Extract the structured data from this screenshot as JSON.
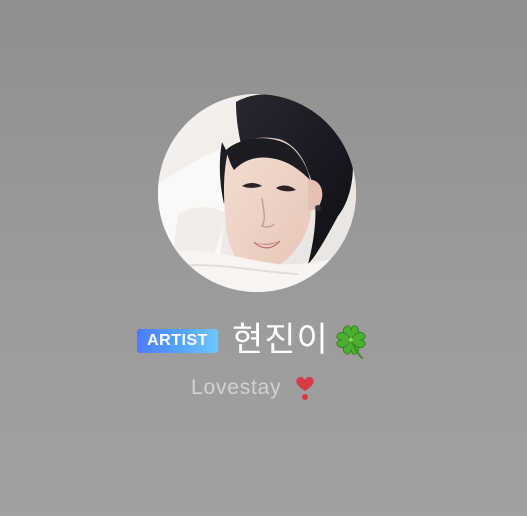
{
  "profile": {
    "badge": "ARTIST",
    "name": "현진이",
    "name_icon": "four-leaf-clover-icon",
    "bio": "Lovestay",
    "bio_icon": "heavy-exclamation-heart-icon"
  },
  "colors": {
    "background": "#9a9a9a",
    "badge_gradient_start": "#4d7bff",
    "badge_gradient_end": "#6cc7ff",
    "name_text": "#ffffff",
    "bio_text": "#d2d2d2",
    "clover": "#4caf2f",
    "heart": "#d83b45"
  }
}
